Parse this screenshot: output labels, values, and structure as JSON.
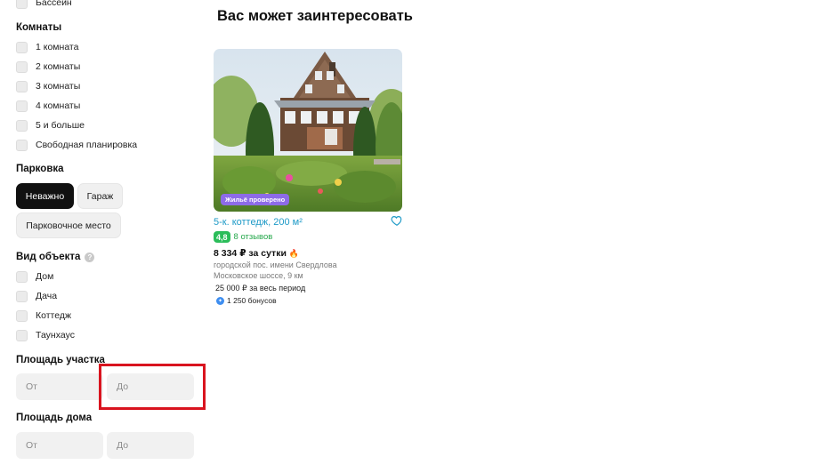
{
  "filters": {
    "pool_label": "Бассейн",
    "rooms": {
      "title": "Комнаты",
      "options": [
        "1 комната",
        "2 комнаты",
        "3 комнаты",
        "4 комнаты",
        "5 и больше",
        "Свободная планировка"
      ]
    },
    "parking": {
      "title": "Парковка",
      "options": [
        "Неважно",
        "Гараж",
        "Парковочное место"
      ],
      "selected": "Неважно"
    },
    "object_type": {
      "title": "Вид объекта",
      "help_glyph": "?",
      "options": [
        "Дом",
        "Дача",
        "Коттедж",
        "Таунхаус"
      ]
    },
    "plot_area": {
      "title": "Площадь участка",
      "from_placeholder": "От",
      "to_placeholder": "До"
    },
    "house_area": {
      "title": "Площадь дома",
      "from_placeholder": "От",
      "to_placeholder": "До"
    }
  },
  "main": {
    "heading": "Вас может заинтересовать",
    "card": {
      "badge": "Жильё проверено",
      "title": "5-к. коттедж, 200 м²",
      "rating": "4,8",
      "reviews": "8 отзывов",
      "price": "8 334 ₽ за сутки",
      "fire_glyph": "🔥",
      "address_line1": "городской пос. имени Свердлова",
      "address_line2": "Московское шоссе, 9 км",
      "period_price": "25 000 ₽ за весь период",
      "bonus_glyph": "✦",
      "bonus": "1 250 бонусов"
    }
  },
  "colors": {
    "highlight": "#d9141f",
    "link_blue": "#1e9ac7",
    "rating_green": "#2bbd5a",
    "badge_purple": "#8d6be8",
    "chip_active": "#111111"
  },
  "icons": {
    "heart": "heart-outline-icon",
    "help": "question-circle-icon",
    "fire": "fire-icon",
    "bonus": "bonus-coin-icon"
  }
}
